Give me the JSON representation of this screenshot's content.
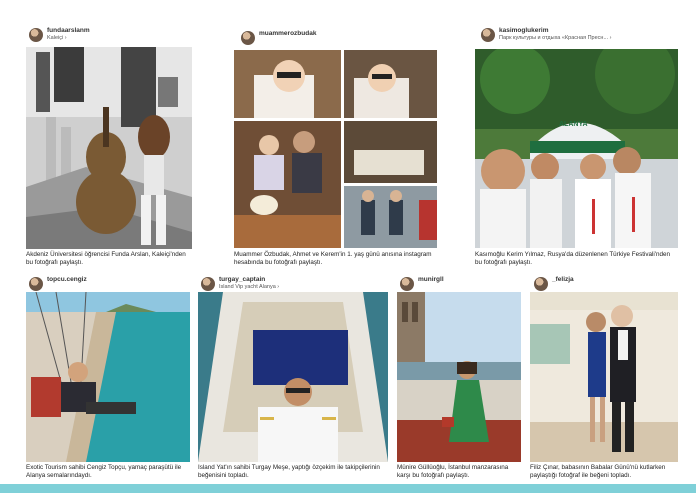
{
  "posts": [
    {
      "username": "fundaarslanm",
      "location": "Kaleiçi ›",
      "caption": "Akdeniz Üniversitesi öğrencisi Funda Arslan, Kaleiçi'nden bu fotoğrafı paylaştı."
    },
    {
      "username": "muammerozbudak",
      "location": "",
      "caption": "Muammer Özbudak, Ahmet ve Kerem'in 1. yaş günü anısına instagram hesabında bu fotoğrafı paylaştı."
    },
    {
      "username": "kasimoglukerim",
      "location": "Парк культуры и отдыха «Красная Пресн... ›",
      "caption": "Kasımoğlu Kerim Yılmaz, Rusya'da düzenlenen Türkiye Festivali'nden bu fotoğrafı paylaştı.",
      "sign": "ALANYA"
    },
    {
      "username": "topcu.cengiz",
      "location": "",
      "caption": "Exotic Tourism sahibi Cengiz Topçu, yamaç paraşütü ile Alanya semalarındaydı."
    },
    {
      "username": "turgay_captain",
      "location": "Island Vip yacht Alanya ›",
      "caption": "Island Yat'ın sahibi Turgay Meşe, yaptığı özçekim ile takipçilerinin beğenisini topladı."
    },
    {
      "username": "munirgll",
      "location": "",
      "caption": "Münire Güllüoğlu, İstanbul manzarasına karşı bu fotoğrafı paylaştı."
    },
    {
      "username": "_felizja",
      "location": "",
      "caption": "Filiz Çınar, babasının Babalar Günü'nü kutlarken paylaştığı fotoğraf ile beğeni topladı."
    }
  ]
}
